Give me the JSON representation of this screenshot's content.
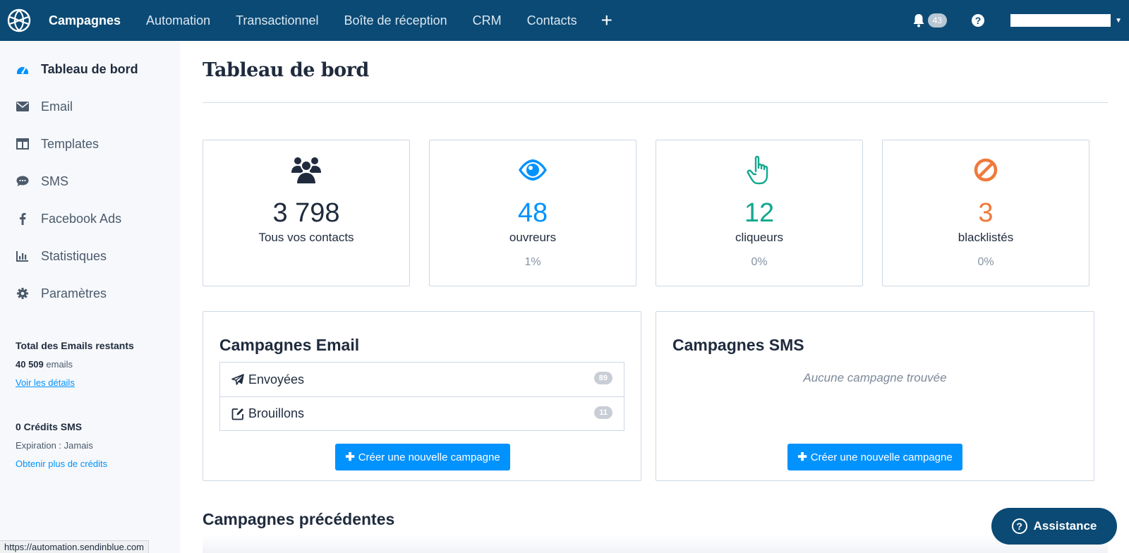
{
  "topnav": {
    "items": [
      "Campagnes",
      "Automation",
      "Transactionnel",
      "Boîte de réception",
      "CRM",
      "Contacts"
    ],
    "plus": "+",
    "notifications_count": "43"
  },
  "sidebar": {
    "items": [
      {
        "label": "Tableau de bord",
        "icon": "dashboard-icon"
      },
      {
        "label": "Email",
        "icon": "envelope-icon"
      },
      {
        "label": "Templates",
        "icon": "template-icon"
      },
      {
        "label": "SMS",
        "icon": "chat-icon"
      },
      {
        "label": "Facebook Ads",
        "icon": "facebook-icon"
      },
      {
        "label": "Statistiques",
        "icon": "bar-chart-icon"
      },
      {
        "label": "Paramètres",
        "icon": "gear-icon"
      }
    ],
    "emails_title": "Total des Emails restants",
    "emails_count": "40 509",
    "emails_unit": "emails",
    "emails_link": "Voir les détails",
    "sms_title": "0 Crédits SMS",
    "sms_expiration": "Expiration : Jamais",
    "sms_link": "Obtenir plus de crédits"
  },
  "main": {
    "title": "Tableau de bord",
    "stats": [
      {
        "value": "3 798",
        "label": "Tous vos contacts",
        "pct": "",
        "color": "#1f2b3d",
        "icon": "users-icon"
      },
      {
        "value": "48",
        "label": "ouvreurs",
        "pct": "1%",
        "color": "#0092ff",
        "icon": "eye-icon"
      },
      {
        "value": "12",
        "label": "cliqueurs",
        "pct": "0%",
        "color": "#13a88e",
        "icon": "pointer-hand-icon"
      },
      {
        "value": "3",
        "label": "blacklistés",
        "pct": "0%",
        "color": "#ef7a3b",
        "icon": "ban-icon"
      }
    ],
    "email_campaigns": {
      "title": "Campagnes Email",
      "rows": [
        {
          "label": "Envoyées",
          "count": "89",
          "icon": "paper-plane-icon"
        },
        {
          "label": "Brouillons",
          "count": "11",
          "icon": "edit-icon"
        }
      ],
      "cta": "Créer une nouvelle campagne"
    },
    "sms_campaigns": {
      "title": "Campagnes SMS",
      "empty": "Aucune campagne trouvée",
      "cta": "Créer une nouvelle campagne"
    },
    "previous_title": "Campagnes précédentes"
  },
  "assistance": "Assistance",
  "status_url": "https://automation.sendinblue.com"
}
